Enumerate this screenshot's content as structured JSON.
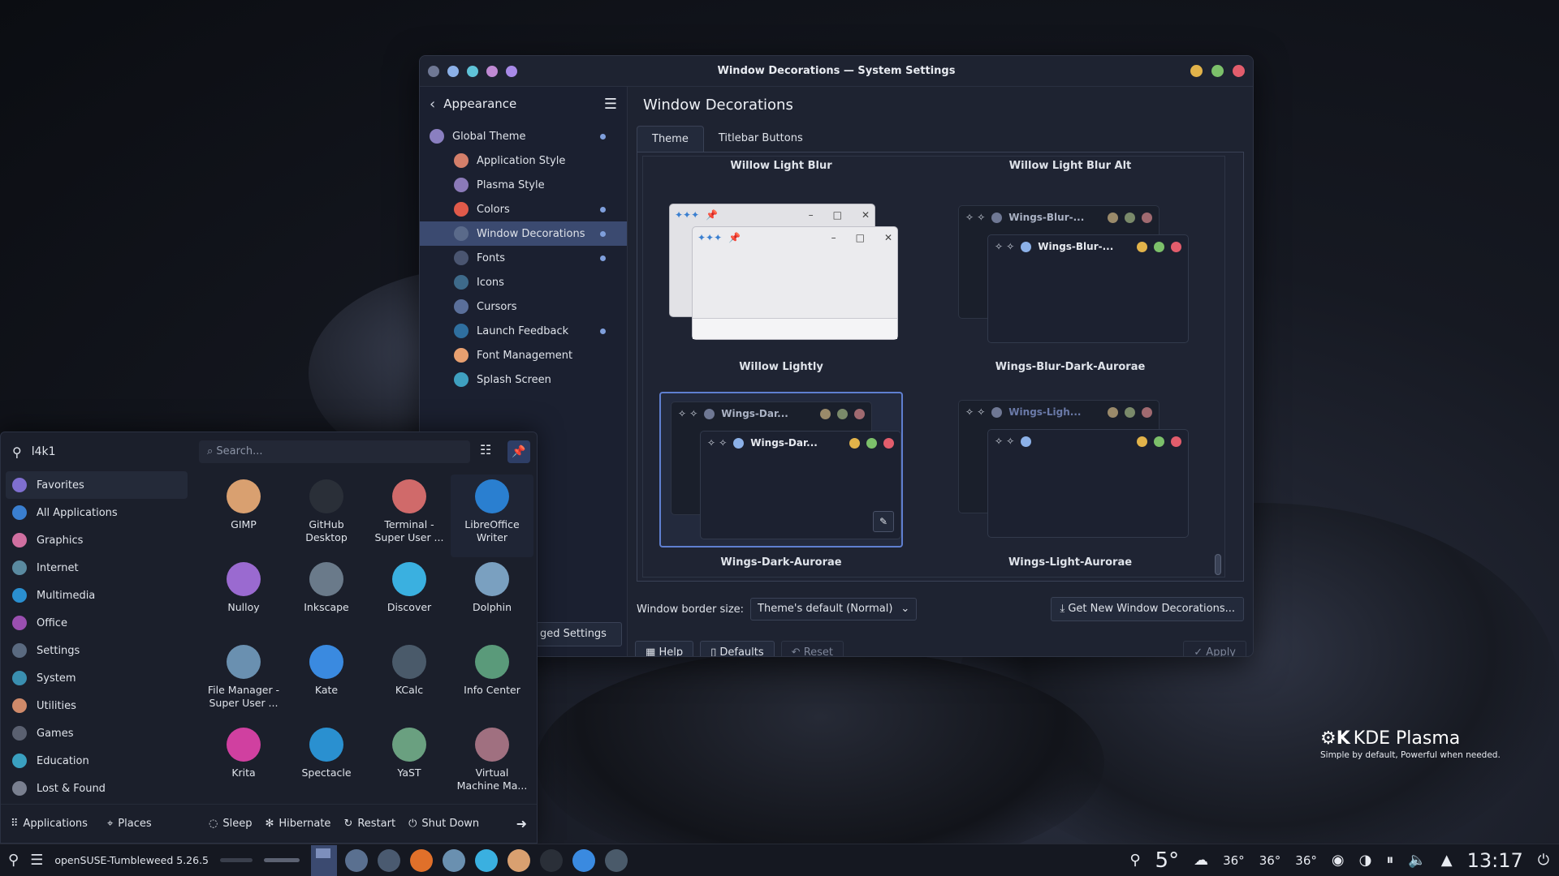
{
  "settings": {
    "window_title": "Window Decorations — System Settings",
    "titlebar_dots": [
      "#6f7894",
      "#8cb1e8",
      "#5fc3d8",
      "#c08ad4",
      "#a88ae8"
    ],
    "window_buttons": {
      "minimize": "#e2b34a",
      "maximize": "#7cc06a",
      "close": "#e25d6c"
    },
    "sidebar": {
      "header": "Appearance",
      "items": [
        {
          "label": "Global Theme",
          "level": "top",
          "dot": true,
          "icon_color": "#8a7fc0"
        },
        {
          "label": "Application Style",
          "level": "sub",
          "dot": false,
          "icon_color": "#d47f6a"
        },
        {
          "label": "Plasma Style",
          "level": "sub",
          "dot": false,
          "icon_color": "#8b7ab8"
        },
        {
          "label": "Colors",
          "level": "sub",
          "dot": true,
          "icon_color": "#e05a4a"
        },
        {
          "label": "Window Decorations",
          "level": "sub",
          "dot": true,
          "active": true,
          "icon_color": "#5a6a8a"
        },
        {
          "label": "Fonts",
          "level": "sub",
          "dot": true,
          "icon_color": "#4a5570"
        },
        {
          "label": "Icons",
          "level": "sub",
          "dot": false,
          "icon_color": "#3e6a8a"
        },
        {
          "label": "Cursors",
          "level": "sub",
          "dot": false,
          "icon_color": "#5a6f9a"
        },
        {
          "label": "Launch Feedback",
          "level": "sub",
          "dot": true,
          "icon_color": "#2f6f9f"
        },
        {
          "label": "Font Management",
          "level": "sub",
          "dot": false,
          "icon_color": "#e8a070"
        },
        {
          "label": "Splash Screen",
          "level": "sub",
          "dot": false,
          "icon_color": "#3fa0c0"
        }
      ]
    },
    "page_title": "Window Decorations",
    "tabs": [
      {
        "label": "Theme",
        "active": true
      },
      {
        "label": "Titlebar Buttons",
        "active": false
      }
    ],
    "top_labels": [
      "Willow Light Blur",
      "Willow Light Blur Alt"
    ],
    "themes": [
      {
        "name": "Willow Lightly",
        "preview_title": ""
      },
      {
        "name": "Wings-Blur-Dark-Aurorae",
        "preview_title": "Wings-Blur-..."
      },
      {
        "name": "Wings-Dark-Aurorae",
        "preview_title": "Wings-Dar...",
        "selected": true
      },
      {
        "name": "Wings-Light-Aurorae",
        "preview_title": "Wings-Ligh..."
      }
    ],
    "border_size_label": "Window border size:",
    "border_size_value": "Theme's default (Normal)",
    "get_new_label": "Get New Window Decorations...",
    "highlight_changed": "ged Settings",
    "footer": {
      "help": "Help",
      "defaults": "Defaults",
      "reset": "Reset",
      "apply": "Apply"
    }
  },
  "launcher": {
    "username": "l4k1",
    "search_placeholder": "Search...",
    "categories": [
      {
        "label": "Favorites",
        "active": true,
        "color": "#7f6fd0"
      },
      {
        "label": "All Applications",
        "color": "#3a7fd0"
      },
      {
        "label": "Graphics",
        "color": "#d06fa0"
      },
      {
        "label": "Internet",
        "color": "#5a8aa0"
      },
      {
        "label": "Multimedia",
        "color": "#2a8fd0"
      },
      {
        "label": "Office",
        "color": "#9a4fb0"
      },
      {
        "label": "Settings",
        "color": "#5a6a80"
      },
      {
        "label": "System",
        "color": "#3a8fb0"
      },
      {
        "label": "Utilities",
        "color": "#d08a6a"
      },
      {
        "label": "Games",
        "color": "#5a6070"
      },
      {
        "label": "Education",
        "color": "#3aa0c0"
      },
      {
        "label": "Lost & Found",
        "color": "#7a8090"
      }
    ],
    "apps": [
      {
        "line1": "GIMP",
        "line2": "",
        "color": "#d9a070"
      },
      {
        "line1": "GitHub",
        "line2": "Desktop",
        "color": "#2a2f38"
      },
      {
        "line1": "Terminal -",
        "line2": "Super User ...",
        "color": "#d06a6a"
      },
      {
        "line1": "LibreOffice",
        "line2": "Writer",
        "color": "#2a7fd0",
        "active": true
      },
      {
        "line1": "Nulloy",
        "line2": "",
        "color": "#9a6ad0"
      },
      {
        "line1": "Inkscape",
        "line2": "",
        "color": "#6a7a8a"
      },
      {
        "line1": "Discover",
        "line2": "",
        "color": "#3ab0e0"
      },
      {
        "line1": "Dolphin",
        "line2": "",
        "color": "#7aa0c0"
      },
      {
        "line1": "File Manager -",
        "line2": "Super User ...",
        "color": "#6a90b0"
      },
      {
        "line1": "Kate",
        "line2": "",
        "color": "#3a8ae0"
      },
      {
        "line1": "KCalc",
        "line2": "",
        "color": "#4a5a6a"
      },
      {
        "line1": "Info Center",
        "line2": "",
        "color": "#5a9a7a"
      },
      {
        "line1": "Krita",
        "line2": "",
        "color": "#d040a0"
      },
      {
        "line1": "Spectacle",
        "line2": "",
        "color": "#2a90d0"
      },
      {
        "line1": "YaST",
        "line2": "",
        "color": "#6aa080"
      },
      {
        "line1": "Virtual",
        "line2": "Machine Ma...",
        "color": "#a07080"
      }
    ],
    "footer": {
      "applications": "Applications",
      "places": "Places",
      "sleep": "Sleep",
      "hibernate": "Hibernate",
      "restart": "Restart",
      "shutdown": "Shut Down"
    }
  },
  "branding": {
    "name": "KDE Plasma",
    "tagline": "Simple by default, Powerful when  needed."
  },
  "taskbar": {
    "window_title": "openSUSE-Tumbleweed 5.26.5",
    "app_colors": [
      "#5a7090",
      "#4a5a70",
      "#e0702a",
      "#6a90b0",
      "#3ab0e0",
      "#d9a070",
      "#2a2f38",
      "#3a8ae0",
      "#4a5a6a"
    ],
    "weather_temp": "5°",
    "temps": [
      "36°",
      "36°",
      "36°"
    ],
    "clock": "13:17"
  }
}
